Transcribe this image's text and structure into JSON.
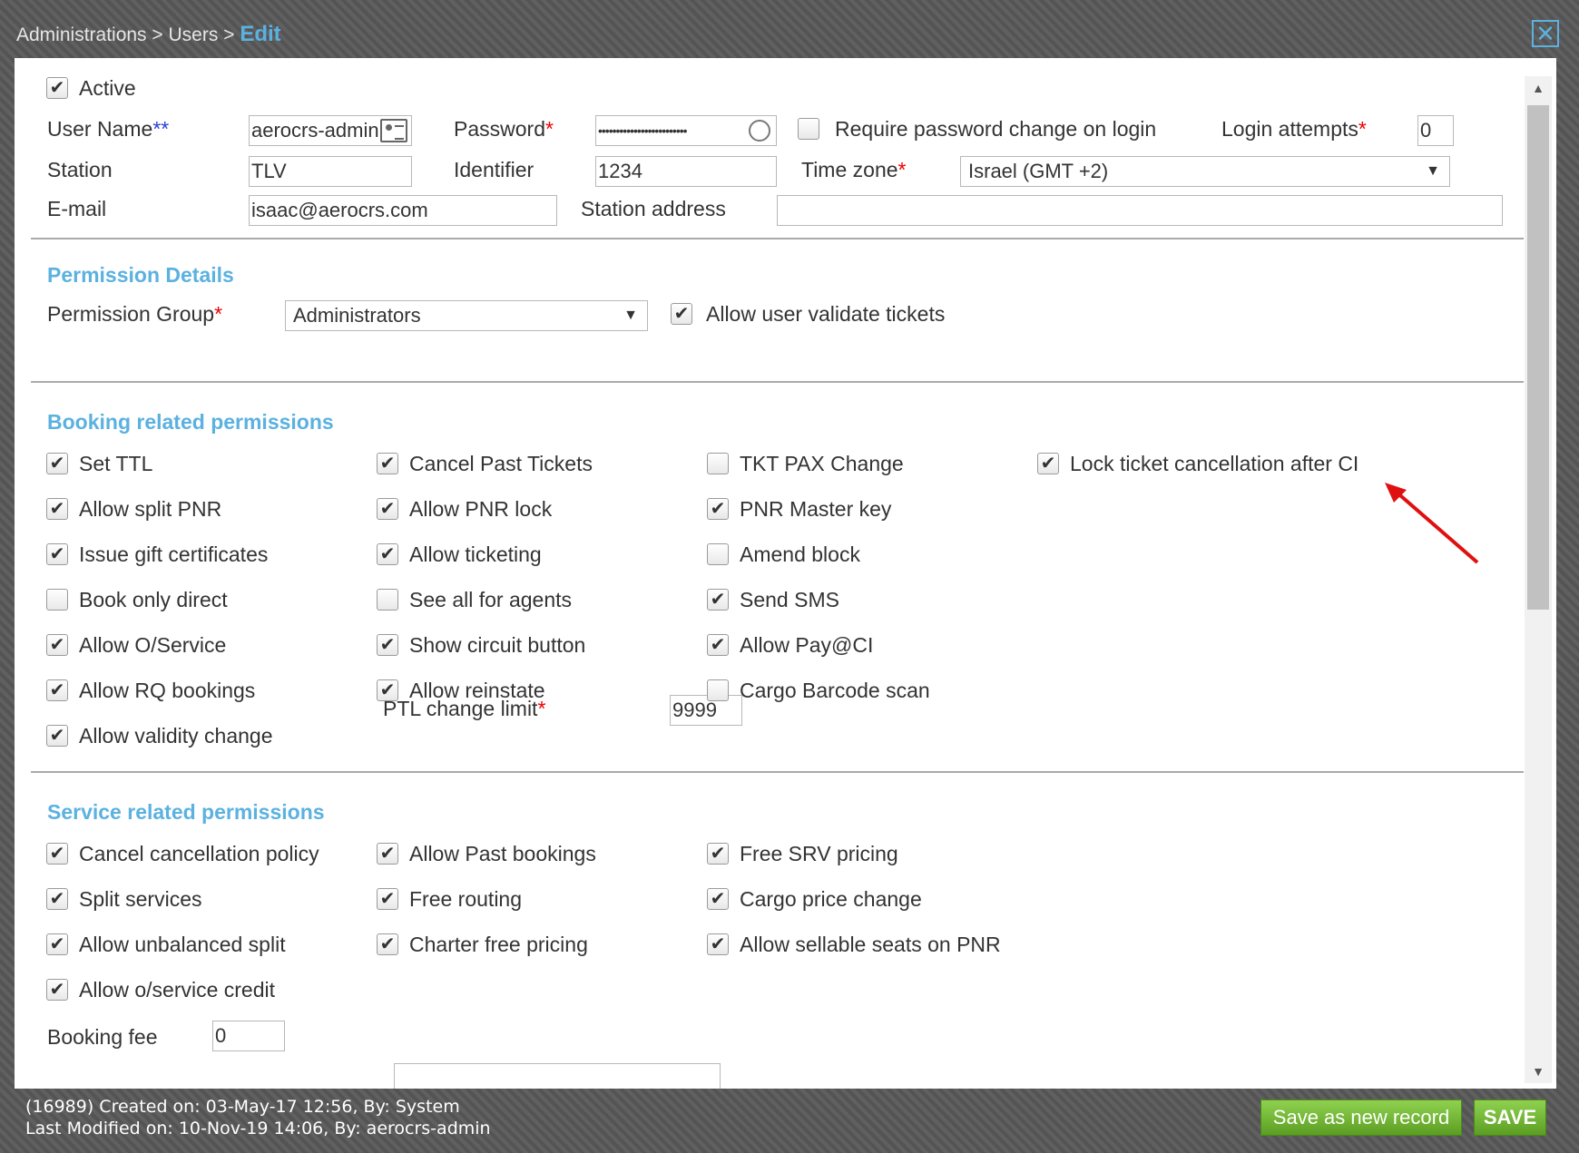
{
  "breadcrumb": {
    "part1": "Administrations",
    "sep1": ">",
    "part2": "Users",
    "sep2": ">",
    "current": "Edit"
  },
  "close_icon": "close-icon",
  "form": {
    "active_label": "Active",
    "active_checked": true,
    "username_label": "User Name",
    "username_req": "**",
    "username_value": "aerocrs-admin",
    "password_label": "Password",
    "password_req": "*",
    "password_value": "•••••••••••••••••••••••••",
    "require_pw_label": "Require password change on login",
    "require_pw_checked": false,
    "login_attempts_label": "Login attempts",
    "login_attempts_req": "*",
    "login_attempts_value": "0",
    "station_label": "Station",
    "station_value": "TLV",
    "identifier_label": "Identifier",
    "identifier_value": "1234",
    "timezone_label": "Time zone",
    "timezone_req": "*",
    "timezone_value": "Israel (GMT +2)",
    "email_label": "E-mail",
    "email_value": "isaac@aerocrs.com",
    "station_address_label": "Station address",
    "station_address_value": ""
  },
  "permission_details": {
    "title": "Permission Details",
    "group_label": "Permission Group",
    "group_req": "*",
    "group_value": "Administrators",
    "validate_label": "Allow user validate tickets",
    "validate_checked": true
  },
  "booking": {
    "title": "Booking related permissions",
    "items": [
      {
        "label": "Set TTL",
        "checked": true
      },
      {
        "label": "Cancel Past Tickets",
        "checked": true
      },
      {
        "label": "TKT PAX Change",
        "checked": false
      },
      {
        "label": "Lock ticket cancellation after CI",
        "checked": true
      },
      {
        "label": "Allow split PNR",
        "checked": true
      },
      {
        "label": "Allow PNR lock",
        "checked": true
      },
      {
        "label": "PNR Master key",
        "checked": true
      },
      {
        "label": "Issue gift certificates",
        "checked": true
      },
      {
        "label": "Allow ticketing",
        "checked": true
      },
      {
        "label": "Amend block",
        "checked": false
      },
      {
        "label": "Book only direct",
        "checked": false
      },
      {
        "label": "See all for agents",
        "checked": false
      },
      {
        "label": "Send SMS",
        "checked": true
      },
      {
        "label": "Allow O/Service",
        "checked": true
      },
      {
        "label": "Show circuit button",
        "checked": true
      },
      {
        "label": "Allow Pay@CI",
        "checked": true
      },
      {
        "label": "Allow RQ bookings",
        "checked": true
      },
      {
        "label": "Allow reinstate",
        "checked": true
      },
      {
        "label": "Cargo Barcode scan",
        "checked": false
      },
      {
        "label": "Allow validity change",
        "checked": true
      }
    ],
    "ptl_label": "PTL change limit",
    "ptl_req": "*",
    "ptl_value": "9999"
  },
  "service": {
    "title": "Service related permissions",
    "items": [
      {
        "label": "Cancel cancellation policy",
        "checked": true
      },
      {
        "label": "Allow Past bookings",
        "checked": true
      },
      {
        "label": "Free SRV pricing",
        "checked": true
      },
      {
        "label": "Split services",
        "checked": true
      },
      {
        "label": "Free routing",
        "checked": true
      },
      {
        "label": "Cargo price change",
        "checked": true
      },
      {
        "label": "Allow unbalanced split",
        "checked": true
      },
      {
        "label": "Charter free pricing",
        "checked": true
      },
      {
        "label": "Allow sellable seats on PNR",
        "checked": true
      },
      {
        "label": "Allow o/service credit",
        "checked": true
      }
    ],
    "booking_fee_label": "Booking fee",
    "booking_fee_value": "0"
  },
  "footer": {
    "created": "(16989) Created on: 03-May-17 12:56, By: System",
    "modified": "Last Modified on: 10-Nov-19 14:06, By: aerocrs-admin"
  },
  "buttons": {
    "save_new": "Save as new record",
    "save": "SAVE"
  },
  "check_glyph": "✔",
  "select_arrow": "▼",
  "annotation_color": "#e01010"
}
